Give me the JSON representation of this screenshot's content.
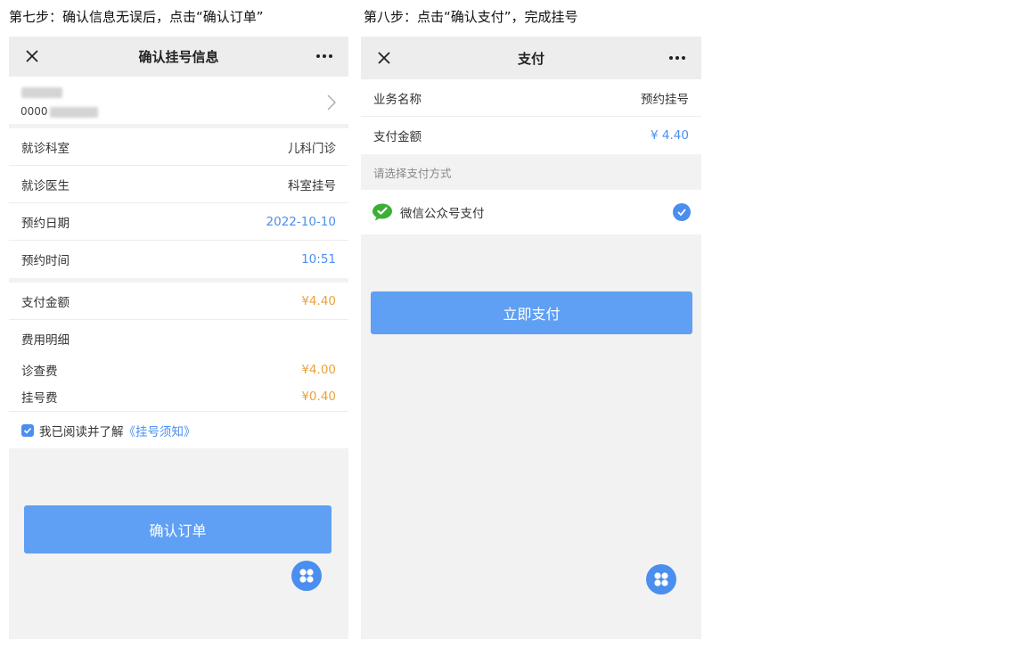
{
  "captions": {
    "step7": "第七步：确认信息无误后，点击“确认订单”",
    "step8": "第八步：点击“确认支付”，完成挂号"
  },
  "screen1": {
    "title": "确认挂号信息",
    "user_id_prefix": "0000",
    "rows": [
      {
        "label": "就诊科室",
        "value": "儿科门诊"
      },
      {
        "label": "就诊医生",
        "value": "科室挂号"
      },
      {
        "label": "预约日期",
        "value": "2022-10-10"
      },
      {
        "label": "预约时间",
        "value": "10:51"
      }
    ],
    "payment": {
      "label": "支付金额",
      "value": "¥4.40"
    },
    "fee_detail_title": "费用明细",
    "fees": [
      {
        "label": "诊查费",
        "value": "¥4.00"
      },
      {
        "label": "挂号费",
        "value": "¥0.40"
      }
    ],
    "agree_text": "我已阅读并了解",
    "agree_link": "《挂号须知》",
    "confirm_label": "确认订单"
  },
  "screen2": {
    "title": "支付",
    "rows": [
      {
        "label": "业务名称",
        "value": "预约挂号"
      },
      {
        "label": "支付金额",
        "value": "¥ 4.40"
      }
    ],
    "hint": "请选择支付方式",
    "method_label": "微信公众号支付",
    "pay_label": "立即支付"
  },
  "colors": {
    "accent": "#4a8ef0",
    "button": "#5fa0f4",
    "price": "#e8a33b",
    "wechat": "#3cb034"
  },
  "icons": {
    "close": "close-icon",
    "more": "more-icon",
    "chevron": "chevron-right-icon",
    "check": "check-icon",
    "wechat": "wechat-icon",
    "float": "grid-menu-icon"
  }
}
